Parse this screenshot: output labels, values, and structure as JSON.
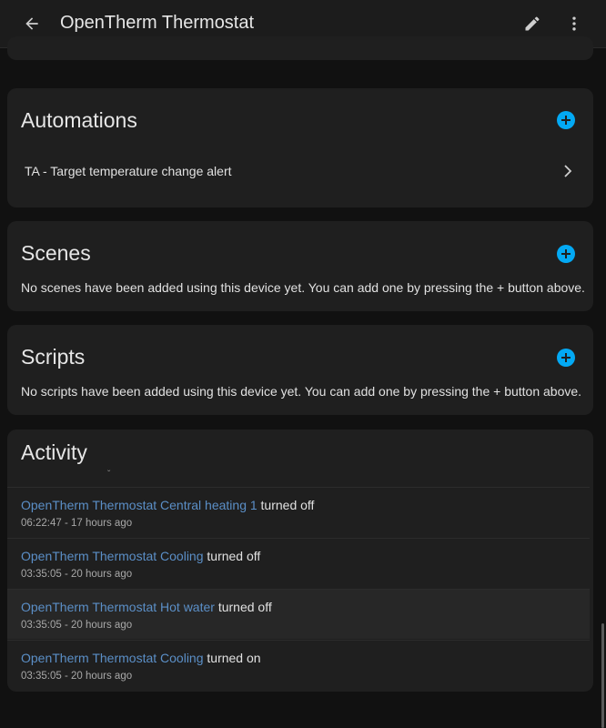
{
  "header": {
    "title": "OpenTherm Thermostat",
    "back_icon": "arrow-left-icon",
    "edit_icon": "pencil-icon",
    "menu_icon": "more-vertical-icon"
  },
  "automations": {
    "title": "Automations",
    "items": [
      {
        "label": "TA - Target temperature change alert"
      }
    ]
  },
  "scenes": {
    "title": "Scenes",
    "empty_text": "No scenes have been added using this device yet. You can add one by pressing the + button above."
  },
  "scripts": {
    "title": "Scripts",
    "empty_text": "No scripts have been added using this device yet. You can add one by pressing the + button above."
  },
  "activity": {
    "title": "Activity",
    "entries": [
      {
        "entity": "OpenTherm Thermostat Central heating 1",
        "action": "turned off",
        "time": "06:22:47 - 17 hours ago"
      },
      {
        "entity": "OpenTherm Thermostat Cooling",
        "action": "turned off",
        "time": "03:35:05 - 20 hours ago"
      },
      {
        "entity": "OpenTherm Thermostat Hot water",
        "action": "turned off",
        "time": "03:35:05 - 20 hours ago"
      },
      {
        "entity": "OpenTherm Thermostat Cooling",
        "action": "turned on",
        "time": "03:35:05 - 20 hours ago"
      }
    ]
  },
  "colors": {
    "background": "#111111",
    "card": "#1f1f1f",
    "accent": "#03a9f4",
    "link": "#5b8fc7"
  }
}
